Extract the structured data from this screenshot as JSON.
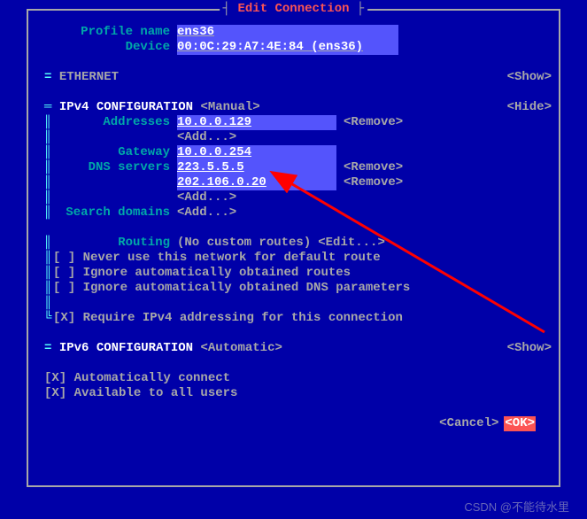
{
  "title": "Edit Connection",
  "profile": {
    "name_label": "Profile name",
    "name_value": "ens36",
    "device_label": "Device",
    "device_value": "00:0C:29:A7:4E:84 (ens36)"
  },
  "ethernet": {
    "header": "ETHERNET",
    "toggle": "<Show>"
  },
  "ipv4": {
    "header": "IPv4 CONFIGURATION",
    "mode": "<Manual>",
    "toggle": "<Hide>",
    "addresses_label": "Addresses",
    "addresses": [
      "10.0.0.129"
    ],
    "add": "<Add...>",
    "gateway_label": "Gateway",
    "gateway": "10.0.0.254",
    "dns_label": "DNS servers",
    "dns": [
      "223.5.5.5",
      "202.106.0.20"
    ],
    "search_label": "Search domains",
    "routing_label": "Routing",
    "routing_text": "(No custom routes)",
    "routing_edit": "<Edit...>",
    "remove": "<Remove>",
    "checkboxes": [
      {
        "checked": false,
        "label": "Never use this network for default route"
      },
      {
        "checked": false,
        "label": "Ignore automatically obtained routes"
      },
      {
        "checked": false,
        "label": "Ignore automatically obtained DNS parameters"
      }
    ],
    "require": {
      "checked": true,
      "label": "Require IPv4 addressing for this connection"
    }
  },
  "ipv6": {
    "header": "IPv6 CONFIGURATION",
    "mode": "<Automatic>",
    "toggle": "<Show>"
  },
  "general": {
    "auto_connect": {
      "checked": true,
      "label": "Automatically connect"
    },
    "all_users": {
      "checked": true,
      "label": "Available to all users"
    }
  },
  "buttons": {
    "cancel": "<Cancel>",
    "ok": "<OK>"
  },
  "watermark": "CSDN @不能待水里",
  "separator": "="
}
